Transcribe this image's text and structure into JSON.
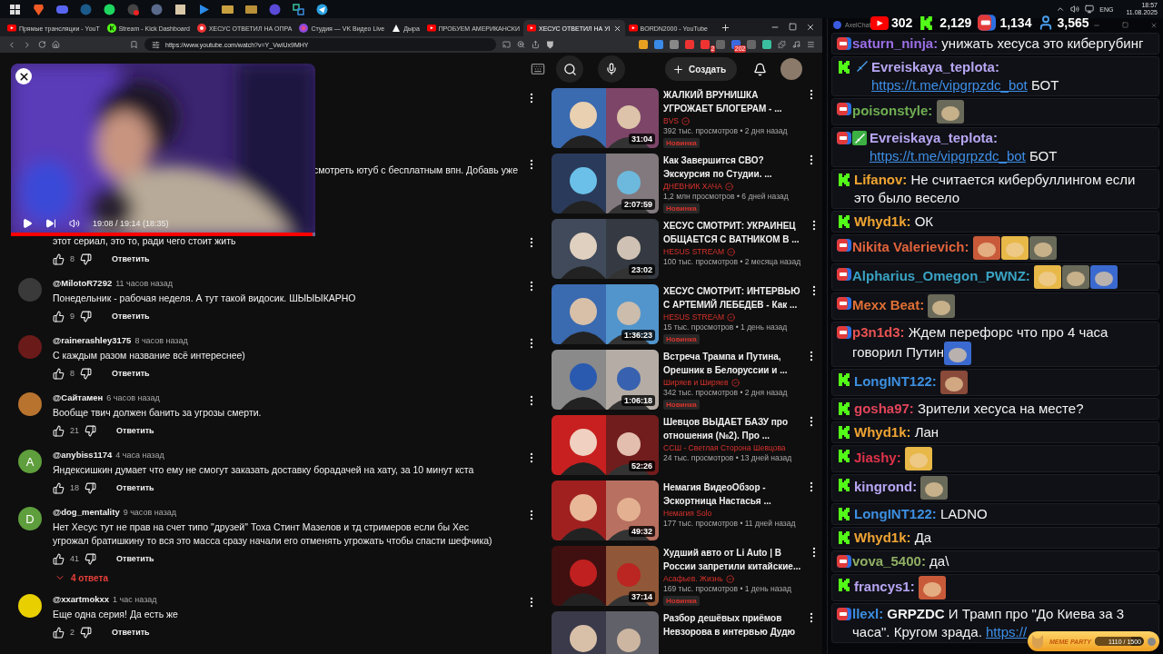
{
  "taskbar": {
    "language": "ENG",
    "time": "18:57",
    "date": "11.08.2025"
  },
  "stats": [
    {
      "kind": "youtube",
      "value": "302"
    },
    {
      "kind": "kick",
      "value": "2,129"
    },
    {
      "kind": "live",
      "value": "1,134"
    },
    {
      "kind": "viewers",
      "value": "3,565"
    }
  ],
  "browser": {
    "tabs": [
      {
        "label": "Прямые трансляции - YouT",
        "kind": "youtube",
        "selected": false
      },
      {
        "label": "Stream - Kick Dashboard",
        "kind": "kick",
        "selected": false
      },
      {
        "label": "ХЕСУС ОТВЕТИЛ НА ОПРА",
        "kind": "live",
        "selected": false
      },
      {
        "label": "Студия — VK Видео Live",
        "kind": "vk",
        "selected": false
      },
      {
        "label": "Дыра",
        "kind": "triangle",
        "selected": false
      },
      {
        "label": "ПРОБУЕМ АМЕРИКАНСКИ",
        "kind": "youtube",
        "selected": false
      },
      {
        "label": "ХЕСУС ОТВЕТИЛ НА УІ",
        "kind": "youtube",
        "selected": true
      },
      {
        "label": "BORDN2000 - YouTube",
        "kind": "youtube",
        "selected": false
      }
    ],
    "url": "https://www.youtube.com/watch?v=Y_VwiUx9MHY",
    "badges": [
      "2",
      "202"
    ]
  },
  "youtube": {
    "create": "Создать",
    "player": {
      "time": "19:08 / 19:14 (18:35)",
      "level": 0.99
    },
    "comments": [
      {
        "kind": "hidden"
      },
      {
        "kind": "fragment",
        "text": "смотреть ютуб с бесплатным впн. Добавь уже"
      },
      {
        "kind": "comment",
        "text": "этот сериал, это то, ради чего стоит жить",
        "likes": "8",
        "reply": "Ответить"
      },
      {
        "kind": "comment",
        "author": "@MilotoR7292",
        "time": "11 часов назад",
        "color": "#3a3a3a",
        "text": "Понедельник - рабочая неделя. А тут такой видосик. ШЫЫЫКАРНО",
        "likes": "9",
        "reply": "Ответить"
      },
      {
        "kind": "comment",
        "author": "@rainerashley3175",
        "time": "8 часов назад",
        "color": "#6b1a1a",
        "text": "С каждым разом название всё интереснее)",
        "likes": "8",
        "reply": "Ответить"
      },
      {
        "kind": "comment",
        "author": "@Сайтамен",
        "time": "6 часов назад",
        "color": "#b8732e",
        "text": "Вообще твич должен банить за угрозы смерти.",
        "likes": "21",
        "reply": "Ответить"
      },
      {
        "kind": "comment",
        "author": "@anybiss1174",
        "time": "4 часа назад",
        "color": "#5e9e3c",
        "letter": "A",
        "text": "Яндексишкин думает что ему не смогут заказать доставку борадачей на хату, за 10 минут кста",
        "likes": "18",
        "reply": "Ответить"
      },
      {
        "kind": "comment",
        "author": "@dog_mentality",
        "time": "9 часов назад",
        "color": "#5e9e3d",
        "letter": "D",
        "text": "Нет Хесус тут не прав на счет типо \"друзей\" Тоха Стинт Мазелов и тд стримеров если бы Хес угрожал братишкину то вся это масса сразу начали его отменять угрожать чтобы спасти шефчика)",
        "likes": "41",
        "reply": "Ответить",
        "replies": "4 ответа"
      },
      {
        "kind": "comment",
        "author": "@xxartmokxx",
        "time": "1 час назад",
        "color": "#e8d000",
        "text": "Еще одна серия! Да есть же",
        "likes": "2",
        "reply": "Ответить"
      }
    ],
    "videos": [
      {
        "title": [
          "ЖАЛКИЙ ВРУНИШКА",
          "УГРОЖАЕТ БЛОГЕРАМ - ..."
        ],
        "channel": "BVS",
        "verified": true,
        "meta": "392 тыс. просмотров • 2 дня назад",
        "duration": "31:04",
        "badge": "Новинка"
      },
      {
        "title": [
          "Как Завершится СВО?",
          "Экскурсия по Студии. ..."
        ],
        "channel": "ДНЕВНИК ХАЧА",
        "verified": true,
        "meta": "1,2 млн просмотров • 6 дней назад",
        "duration": "2:07:59",
        "badge": "Новинка"
      },
      {
        "title": [
          "ХЕСУС СМОТРИТ: УКРАИНЕЦ",
          "ОБЩАЕТСЯ С ВАТНИКОМ В ..."
        ],
        "channel": "HESUS STREAM",
        "verified": true,
        "meta": "100 тыс. просмотров • 2 месяца назад",
        "duration": "23:02"
      },
      {
        "title": [
          "ХЕСУС СМОТРИТ: ИНТЕРВЬЮ",
          "С АРТЕМИЙ ЛЕБЕДЕВ - Как ..."
        ],
        "channel": "HESUS STREAM",
        "verified": true,
        "meta": "15 тыс. просмотров • 1 день назад",
        "duration": "1:36:23",
        "badge": "Новинка"
      },
      {
        "title": [
          "Встреча Трампа и Путина,",
          "Орешник в Белоруссии и ..."
        ],
        "channel": "Ширяев и Ширяев",
        "verified": true,
        "meta": "342 тыс. просмотров • 2 дня назад",
        "duration": "1:06:18",
        "badge": "Новинка"
      },
      {
        "title": [
          "Шевцов ВЫДАЕТ БАЗУ про",
          "отношения (№2). Про ..."
        ],
        "channel": "ССШ - Светлая Сторона Шевцова",
        "verified": false,
        "meta": "24 тыс. просмотров • 13 дней назад",
        "duration": "52:26"
      },
      {
        "title": [
          "Немагия ВидеоОбзор -",
          "Эскортница Настасья ..."
        ],
        "channel": "Немагия Solo",
        "verified": false,
        "meta": "177 тыс. просмотров • 11 дней назад",
        "duration": "49:32"
      },
      {
        "title": [
          "Худший авто от Li Auto | В",
          "России запретили китайские..."
        ],
        "channel": "Асафьев. Жизнь",
        "verified": true,
        "meta": "169 тыс. просмотров • 1 день назад",
        "duration": "37:14",
        "badge": "Новинка"
      },
      {
        "title": [
          "Разбор дешёвых приёмов",
          "Невзорова в интервью Дудю"
        ]
      }
    ]
  },
  "chat": {
    "title": "AxelChat",
    "messages": [
      {
        "kind": "live",
        "author": "saturn_ninja:",
        "color": "#9b6fe6",
        "parts": [
          {
            "kind": "text",
            "text": "унижать хесуса это кибергубинг"
          }
        ]
      },
      {
        "kind": "kick",
        "icons": [
          {
            "kind": "sword"
          }
        ],
        "author": "Evreiskaya_teplota:",
        "color": "#b8a6f2",
        "parts": [
          {
            "kind": "link",
            "text": "https://t.me/vipgrpzdc_bot"
          },
          {
            "kind": "text",
            "text": "БОТ"
          }
        ]
      },
      {
        "kind": "live",
        "author": "poisonstyle:",
        "color": "#6fae52",
        "parts": [
          {
            "kind": "emote"
          }
        ]
      },
      {
        "kind": "live",
        "icons": [
          {
            "kind": "moderator"
          }
        ],
        "author": "Evreiskaya_teplota:",
        "color": "#b8a6f3",
        "parts": [
          {
            "kind": "link",
            "text": "https://t.me/vipgrpzdc_bot"
          },
          {
            "kind": "text",
            "text": "БОТ"
          }
        ]
      },
      {
        "kind": "kick",
        "author": "Lifanov:",
        "color": "#f0a531",
        "parts": [
          {
            "kind": "text",
            "text": "Не считается кибербуллингом если это было весело"
          }
        ]
      },
      {
        "kind": "kick",
        "author": "Whyd1k:",
        "color": "#f0a532",
        "parts": [
          {
            "kind": "text",
            "text": "ОК"
          }
        ]
      },
      {
        "kind": "live",
        "author": "Nikita Valerievich:",
        "color": "#e2633c",
        "parts": [
          {
            "kind": "emote"
          },
          {
            "kind": "emote"
          },
          {
            "kind": "emote"
          }
        ]
      },
      {
        "kind": "live",
        "author": "Alpharius_Omegon_PWNZ:",
        "color": "#3aa3c4",
        "parts": [
          {
            "kind": "emote"
          },
          {
            "kind": "emote"
          },
          {
            "kind": "emote"
          }
        ]
      },
      {
        "kind": "live",
        "author": "Mexx Beat:",
        "color": "#e07035",
        "parts": [
          {
            "kind": "emote"
          }
        ]
      },
      {
        "kind": "live",
        "author": "p3n1d3:",
        "color": "#e85252",
        "parts": [
          {
            "kind": "text",
            "text": "Ждем перефорс что про 4 часа говорил Путин"
          },
          {
            "kind": "emote"
          }
        ]
      },
      {
        "kind": "kick",
        "author": "LongINT122:",
        "color": "#3d8fe0",
        "parts": [
          {
            "kind": "emote"
          }
        ]
      },
      {
        "kind": "kick",
        "author": "gosha97:",
        "color": "#e2455a",
        "parts": [
          {
            "kind": "text",
            "text": "Зрители хесуса на месте?"
          }
        ]
      },
      {
        "kind": "kick",
        "author": "Whyd1k:",
        "color": "#f0a533",
        "parts": [
          {
            "kind": "text",
            "text": "Лан"
          }
        ]
      },
      {
        "kind": "kick",
        "author": "Jiashy:",
        "color": "#e0334a",
        "parts": [
          {
            "kind": "emote"
          }
        ]
      },
      {
        "kind": "kick",
        "author": "kingrond:",
        "color": "#b8a6f4",
        "parts": [
          {
            "kind": "emote"
          }
        ]
      },
      {
        "kind": "kick",
        "author": "LongINT122:",
        "color": "#3d8fe1",
        "parts": [
          {
            "kind": "text",
            "text": "LADNO"
          }
        ]
      },
      {
        "kind": "kick",
        "author": "Whyd1k:",
        "color": "#f0a534",
        "parts": [
          {
            "kind": "text",
            "text": "Да"
          }
        ]
      },
      {
        "kind": "live",
        "author": "vova_5400:",
        "color": "#8fae63",
        "parts": [
          {
            "kind": "text",
            "text": "да\\"
          }
        ]
      },
      {
        "kind": "kick",
        "author": "francys1:",
        "color": "#b8a6f5",
        "parts": [
          {
            "kind": "emote"
          }
        ]
      },
      {
        "kind": "live",
        "author": "llexl:",
        "color": "#3d8fe2",
        "parts": [
          {
            "kind": "text",
            "text": "**GRPZDC** И Трамп про \"До Киева за 3 часа\". Кругом зрада."
          },
          {
            "kind": "link",
            "text": "https://"
          }
        ]
      }
    ],
    "meme_party": {
      "title": "MEME PARTY",
      "progress": "1110 / 1500",
      "level": 0.74
    }
  }
}
